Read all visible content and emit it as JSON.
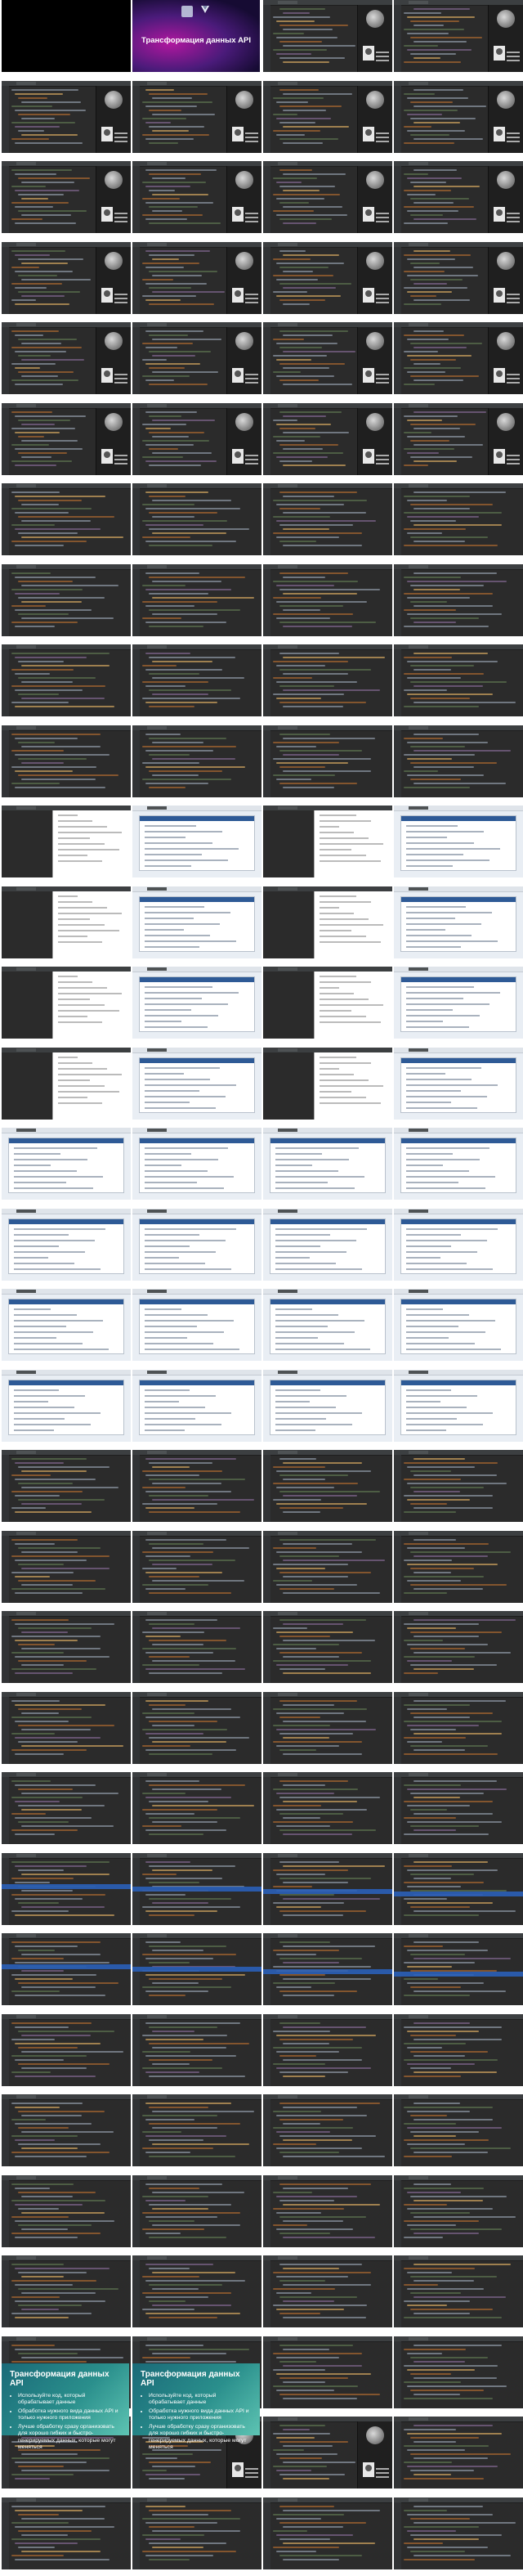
{
  "hero": {
    "title": "Трансформация данных API"
  },
  "closing_slides": [
    {
      "title": "Трансформация данных API",
      "bullets": [
        "Используйте код, который обрабатывает данные",
        "Обработка нужного вида данных API и только нужного приложения",
        "Лучше обработку сразу организовать для хорошо гибких и быстро-генерируемых данных, которые могут меняться"
      ]
    },
    {
      "title": "Трансформация данных API",
      "bullets": [
        "Используйте код, который обрабатывает данные",
        "Обработка нужного вида данных API и только нужного приложения",
        "Лучше обработку сразу организовать для хорошо гибких и быстро-генерируемых данных, которые могут меняться"
      ]
    }
  ],
  "theme": {
    "ide_bg": "#2b2b2b",
    "keyword": "#cc7832",
    "string": "#6a8759",
    "member": "#9876aa",
    "function": "#ffc66d",
    "hero_accent": "#b1179f",
    "slide_accent": "#2a8f8c"
  }
}
